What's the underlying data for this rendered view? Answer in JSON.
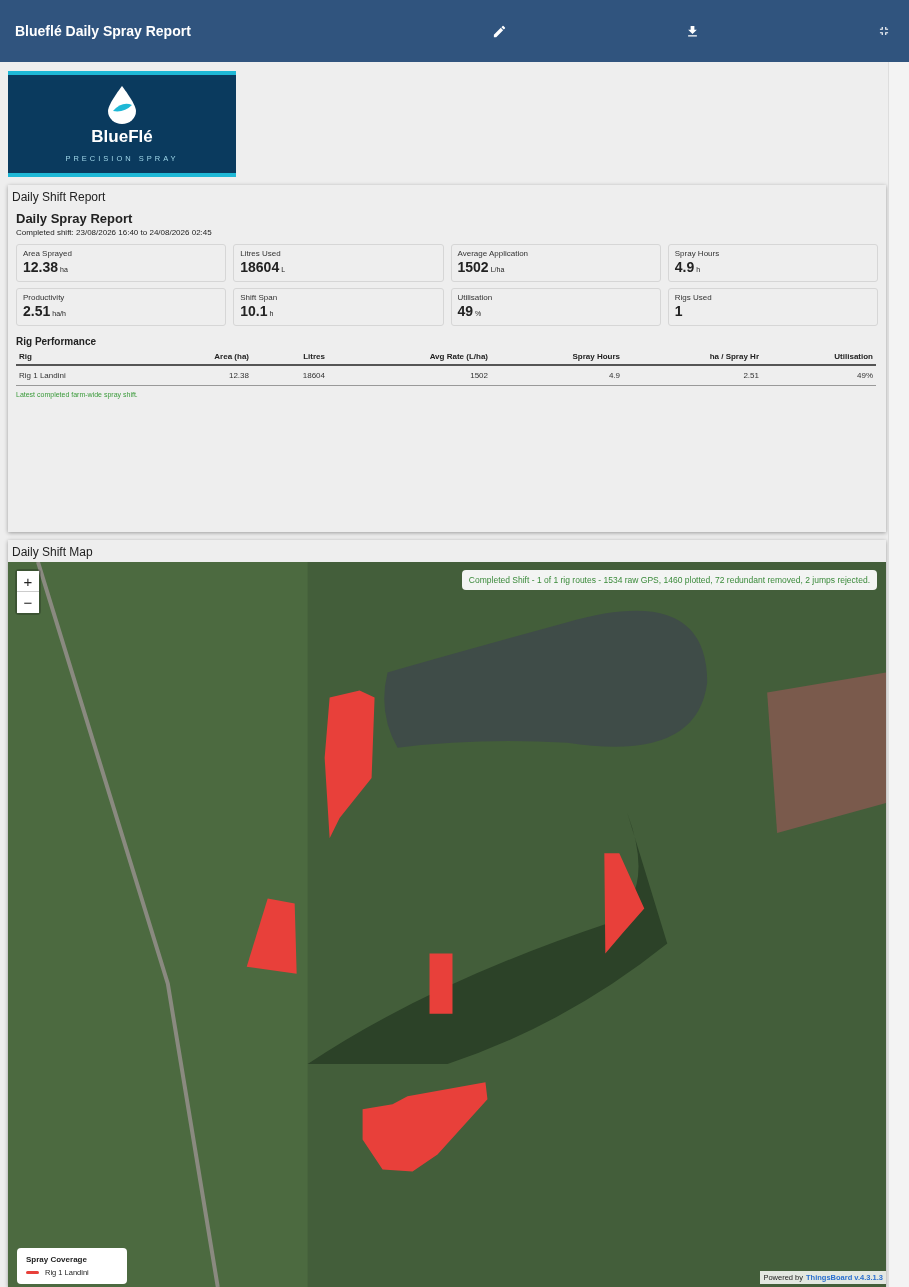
{
  "header": {
    "title": "Blueflé Daily Spray Report"
  },
  "logo": {
    "name": "BlueFlé",
    "tagline": "PRECISION SPRAY"
  },
  "report_card": {
    "title": "Daily Shift Report",
    "heading": "Daily Spray Report",
    "subtitle": "Completed shift: 23/08/2026 16:40 to 24/08/2026 02:45",
    "stats": [
      {
        "label": "Area Sprayed",
        "value": "12.38",
        "unit": "ha"
      },
      {
        "label": "Litres Used",
        "value": "18604",
        "unit": "L"
      },
      {
        "label": "Average Application",
        "value": "1502",
        "unit": "L/ha"
      },
      {
        "label": "Spray Hours",
        "value": "4.9",
        "unit": "h"
      },
      {
        "label": "Productivity",
        "value": "2.51",
        "unit": "ha/h"
      },
      {
        "label": "Shift Span",
        "value": "10.1",
        "unit": "h"
      },
      {
        "label": "Utilisation",
        "value": "49",
        "unit": "%"
      },
      {
        "label": "Rigs Used",
        "value": "1"
      }
    ],
    "table_title": "Rig Performance",
    "table": {
      "columns": [
        "Rig",
        "Area (ha)",
        "Litres",
        "Avg Rate (L/ha)",
        "Spray Hours",
        "ha / Spray Hr",
        "Utilisation"
      ],
      "rows": [
        [
          "Rig 1 Landini",
          "12.38",
          "18604",
          "1502",
          "4.9",
          "2.51",
          "49%"
        ]
      ]
    },
    "note": "Latest completed farm-wide spray shift."
  },
  "map_card": {
    "title": "Daily Shift Map",
    "zoom_in": "+",
    "zoom_out": "−",
    "status": "Completed Shift - 1 of 1 rig routes - 1534 raw GPS, 1460 plotted, 72 redundant removed, 2 jumps rejected.",
    "legend": {
      "title": "Spray Coverage",
      "items": [
        {
          "label": "Rig 1 Landini",
          "color": "#e8403a"
        }
      ]
    },
    "attribution": {
      "prefix": "Powered by",
      "link": "ThingsBoard v.4.3.1.3"
    }
  }
}
